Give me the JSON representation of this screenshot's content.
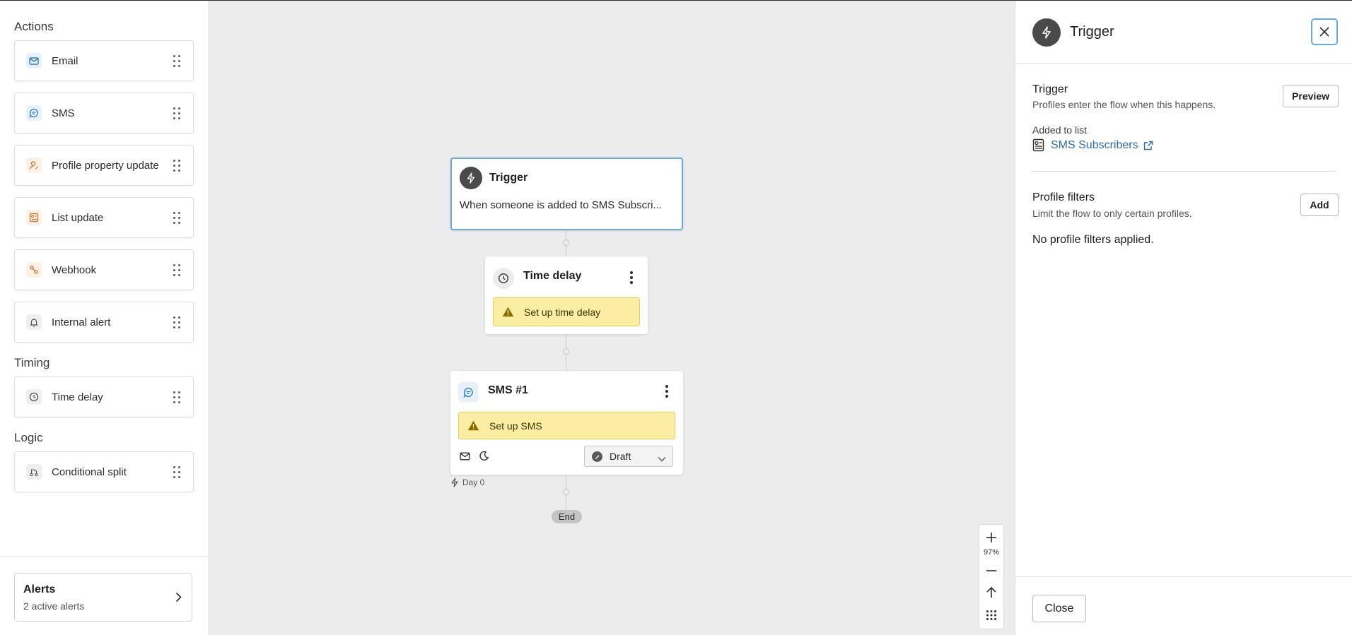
{
  "sidebar": {
    "actions_title": "Actions",
    "actions": [
      {
        "label": "Email",
        "icon": "email-icon",
        "color": "#2f7bbf"
      },
      {
        "label": "SMS",
        "icon": "sms-icon",
        "color": "#2f7bbf"
      },
      {
        "label": "Profile property update",
        "icon": "profile-property-icon",
        "color": "#c7742a"
      },
      {
        "label": "List update",
        "icon": "list-update-icon",
        "color": "#c7742a"
      },
      {
        "label": "Webhook",
        "icon": "webhook-icon",
        "color": "#c7742a"
      },
      {
        "label": "Internal alert",
        "icon": "bell-icon",
        "color": "#555555"
      }
    ],
    "timing_title": "Timing",
    "timing": [
      {
        "label": "Time delay",
        "icon": "clock-icon"
      }
    ],
    "logic_title": "Logic",
    "logic": [
      {
        "label": "Conditional split",
        "icon": "split-icon"
      }
    ],
    "alerts": {
      "title": "Alerts",
      "subtitle": "2 active alerts"
    }
  },
  "canvas": {
    "trigger_node": {
      "title": "Trigger",
      "text": "When someone is added to SMS Subscri..."
    },
    "delay_node": {
      "title": "Time delay",
      "warning": "Set up time delay"
    },
    "sms_node": {
      "title": "SMS #1",
      "warning": "Set up SMS",
      "status": "Draft"
    },
    "day_label": "Day 0",
    "end_label": "End",
    "zoom": "97%"
  },
  "panel": {
    "title": "Trigger",
    "section_title": "Trigger",
    "section_subtitle": "Profiles enter the flow when this happens.",
    "preview_button": "Preview",
    "added_label": "Added to list",
    "list_name": "SMS Subscribers",
    "filters_title": "Profile filters",
    "filters_subtitle": "Limit the flow to only certain profiles.",
    "add_button": "Add",
    "no_filters": "No profile filters applied.",
    "close_button": "Close"
  },
  "colors": {
    "accent": "#6aa9dd",
    "link": "#2b6cb0",
    "warning_bg": "#fbeea3",
    "warning_icon": "#8a6d00"
  }
}
